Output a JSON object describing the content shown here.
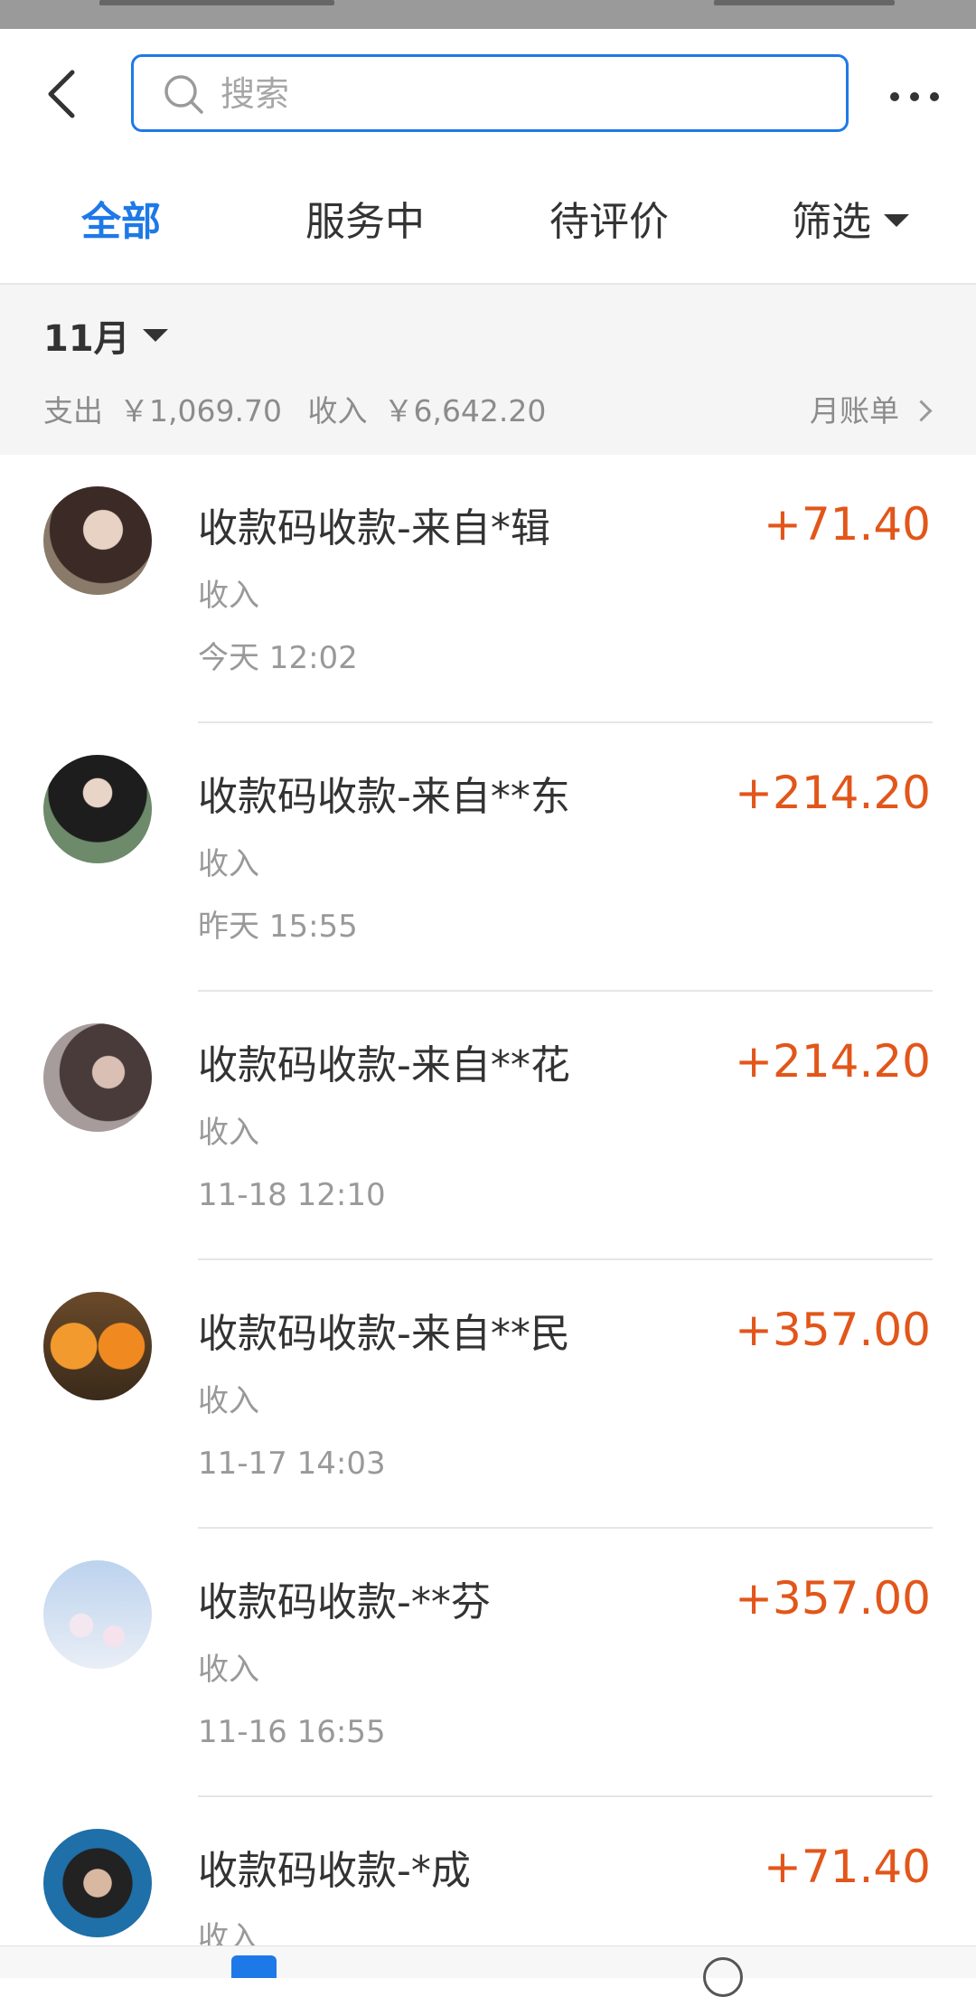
{
  "search": {
    "placeholder": "搜索"
  },
  "tabs": [
    {
      "label": "全部",
      "active": true
    },
    {
      "label": "服务中",
      "active": false
    },
    {
      "label": "待评价",
      "active": false
    },
    {
      "label": "筛选",
      "active": false
    }
  ],
  "month": {
    "label": "11月",
    "expense_label": "支出",
    "expense_value": "￥1,069.70",
    "income_label": "收入",
    "income_value": "￥6,642.20",
    "bill_link": "月账单"
  },
  "transactions": [
    {
      "title": "收款码收款-来自*辑",
      "type": "收入",
      "time": "今天 12:02",
      "amount": "+71.40",
      "avatar": "user-photo-1"
    },
    {
      "title": "收款码收款-来自**东",
      "type": "收入",
      "time": "昨天 15:55",
      "amount": "+214.20",
      "avatar": "user-photo-2"
    },
    {
      "title": "收款码收款-来自**花",
      "type": "收入",
      "time": "11-18 12:10",
      "amount": "+214.20",
      "avatar": "user-photo-3"
    },
    {
      "title": "收款码收款-来自**民",
      "type": "收入",
      "time": "11-17 14:03",
      "amount": "+357.00",
      "avatar": "orange-emoji-photo"
    },
    {
      "title": "收款码收款-**芬",
      "type": "收入",
      "time": "11-16 16:55",
      "amount": "+357.00",
      "avatar": "flower-photo"
    },
    {
      "title": "收款码收款-*成",
      "type": "收入",
      "time": "",
      "amount": "+71.40",
      "avatar": "user-photo-4"
    }
  ],
  "colors": {
    "accent": "#1e79e8",
    "income_amount": "#e2561a",
    "muted_text": "#999999"
  },
  "icons": {
    "back": "back-arrow-icon",
    "search": "search-icon",
    "more": "more-dots-icon",
    "caret": "caret-down-icon",
    "chevron": "chevron-right-icon"
  }
}
